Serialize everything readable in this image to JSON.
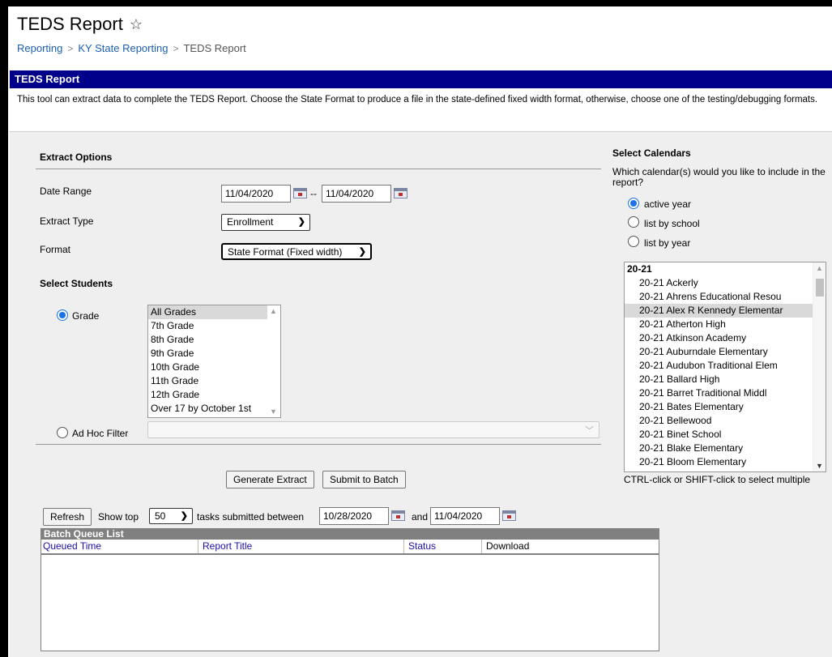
{
  "page": {
    "title": "TEDS Report",
    "breadcrumb": [
      "Reporting",
      "KY State Reporting",
      "TEDS Report"
    ]
  },
  "banner": {
    "title": "TEDS Report"
  },
  "description": "This tool can extract data to complete the TEDS Report. Choose the State Format to produce a file in the state-defined fixed width format, otherwise, choose one of the testing/debugging formats.",
  "extract_options": {
    "heading": "Extract Options",
    "date_range_label": "Date Range",
    "date_start": "11/04/2020",
    "date_separator": "--",
    "date_end": "11/04/2020",
    "extract_type_label": "Extract Type",
    "extract_type_value": "Enrollment",
    "format_label": "Format",
    "format_value": "State Format (Fixed width)"
  },
  "select_students": {
    "heading": "Select Students",
    "grade_label": "Grade",
    "grades": [
      "All Grades",
      "7th Grade",
      "8th Grade",
      "9th Grade",
      "10th Grade",
      "11th Grade",
      "12th Grade",
      "Over 17 by October 1st"
    ],
    "selected_grade": "All Grades",
    "adhoc_label": "Ad Hoc Filter"
  },
  "buttons": {
    "generate": "Generate Extract",
    "submit_batch": "Submit to Batch",
    "refresh": "Refresh"
  },
  "batch": {
    "show_top_label": "Show top",
    "show_top_value": "50",
    "between_label": "tasks submitted between",
    "from_date": "10/28/2020",
    "and_label": "and",
    "to_date": "11/04/2020",
    "list_title": "Batch Queue List",
    "columns": [
      "Queued Time",
      "Report Title",
      "Status",
      "Download"
    ]
  },
  "calendars": {
    "heading": "Select Calendars",
    "question": "Which calendar(s) would you like to include in the report?",
    "options": [
      "active year",
      "list by school",
      "list by year"
    ],
    "selected_option": "active year",
    "group": "20-21",
    "items": [
      "20-21 Ackerly",
      "20-21 Ahrens Educational Resou",
      "20-21 Alex R Kennedy Elementar",
      "20-21 Atherton High",
      "20-21 Atkinson Academy",
      "20-21 Auburndale Elementary",
      "20-21 Audubon Traditional Elem",
      "20-21 Ballard High",
      "20-21 Barret Traditional Middl",
      "20-21 Bates Elementary",
      "20-21 Bellewood",
      "20-21 Binet School",
      "20-21 Blake Elementary",
      "20-21 Bloom Elementary"
    ],
    "selected_item": "20-21 Alex R Kennedy Elementar",
    "hint": "CTRL-click or SHIFT-click to select multiple"
  },
  "icons": {
    "favorite": "star-outline-icon",
    "calendar": "calendar-icon",
    "dropdown": "chevron-down-icon"
  },
  "colors": {
    "banner": "#00008b",
    "link": "#1a5fb4",
    "radio_selected": "#1a73e8",
    "batch_header": "#808080"
  }
}
